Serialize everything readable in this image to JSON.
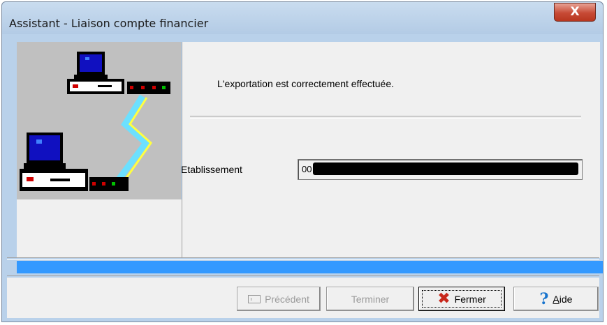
{
  "window": {
    "title": "Assistant - Liaison compte financier",
    "close_label": "X"
  },
  "content": {
    "message": "L'exportation est correctement effectuée.",
    "field_label": "Etablissement",
    "field_value": "00"
  },
  "progress": {
    "fraction": 1.0,
    "color": "#3399ff"
  },
  "buttons": {
    "previous_label": "Précédent",
    "finish_label": "Terminer",
    "close_label": "Fermer",
    "help_label_prefix": "",
    "help_label_accel": "A",
    "help_label_rest": "ide"
  },
  "icons": {
    "previous": "previous-page-icon",
    "close": "red-x-icon",
    "help": "question-mark-icon",
    "illustration": "network-computers-icon"
  }
}
